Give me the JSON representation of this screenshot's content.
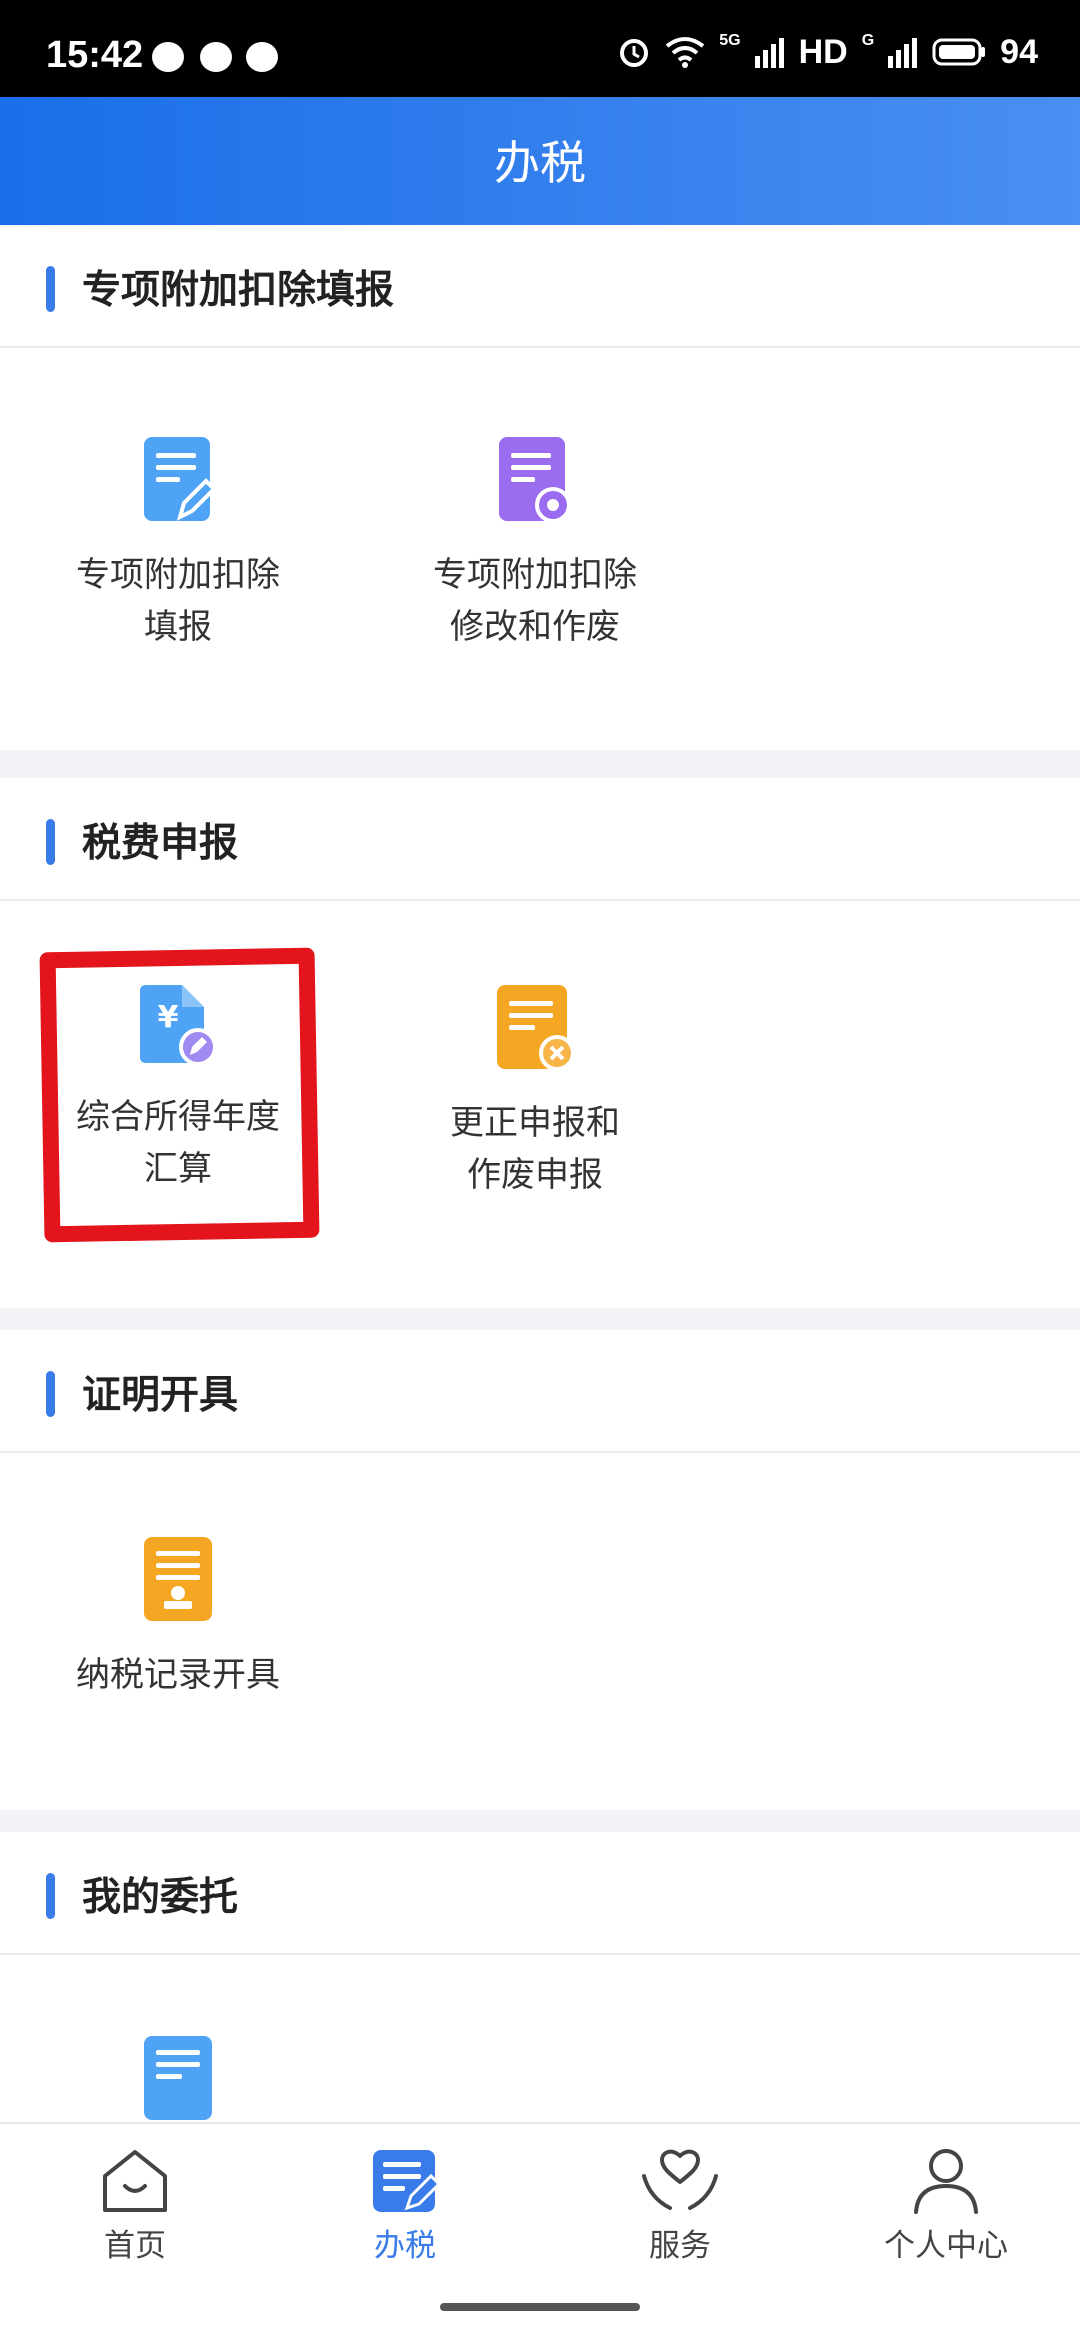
{
  "status_bar": {
    "time": "15:42",
    "network_1": "5G",
    "hd": "HD",
    "network_2": "G",
    "battery": "94",
    "icons": [
      "notification-bubble-icon",
      "message-icon",
      "chat-icon",
      "alarm-icon",
      "wifi-icon",
      "signal-icon",
      "battery-icon"
    ]
  },
  "header": {
    "title": "办税"
  },
  "sections": [
    {
      "title": "专项附加扣除填报",
      "items": [
        {
          "label": "专项附加扣除填报",
          "label_line1": "专项附加扣除",
          "label_line2": "填报",
          "icon": "document-edit-icon",
          "color": "#4ea3f5"
        },
        {
          "label": "专项附加扣除修改和作废",
          "label_line1": "专项附加扣除",
          "label_line2": "修改和作废",
          "icon": "document-settings-icon",
          "color": "#9b6cf0"
        }
      ]
    },
    {
      "title": "税费申报",
      "items": [
        {
          "label": "综合所得年度汇算",
          "label_line1": "综合所得年度",
          "label_line2": "汇算",
          "icon": "yuan-document-icon",
          "color": "#4ea3f5",
          "highlighted": true
        },
        {
          "label": "更正申报和作废申报",
          "label_line1": "更正申报和",
          "label_line2": "作废申报",
          "icon": "document-cancel-icon",
          "color": "#f5a623"
        }
      ]
    },
    {
      "title": "证明开具",
      "items": [
        {
          "label": "纳税记录开具",
          "label_line1": "纳税记录开具",
          "icon": "document-stamp-icon",
          "color": "#f5a623"
        }
      ]
    },
    {
      "title": "我的委托",
      "items": [
        {
          "label": "",
          "icon": "document-icon",
          "color": "#4ea3f5"
        }
      ]
    }
  ],
  "bottom_nav": [
    {
      "label": "首页",
      "icon": "home-icon",
      "active": false
    },
    {
      "label": "办税",
      "icon": "tax-document-icon",
      "active": true
    },
    {
      "label": "服务",
      "icon": "heart-hand-icon",
      "active": false
    },
    {
      "label": "个人中心",
      "icon": "person-icon",
      "active": false
    }
  ],
  "colors": {
    "accent": "#3a7bea",
    "highlight_mark": "#e3141b"
  }
}
